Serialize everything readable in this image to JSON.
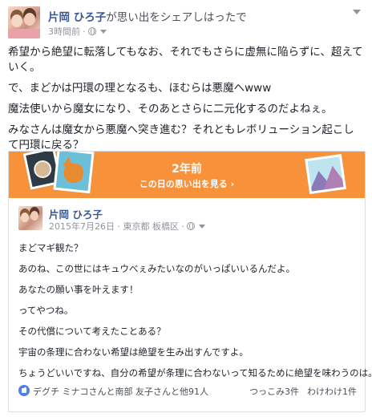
{
  "post": {
    "author": "片岡 ひろ子",
    "action": "が思い出をシェアしはったで",
    "time": "3時間前",
    "time_sep": "·",
    "paragraphs": [
      "希望から絶望に転落してもなお、それでもさらに虚無に陥らずに、超えていく。",
      "で、まどかは円環の理となるも、ほむらは悪魔へwww",
      "魔法使いから魔女になり、そのあとさらに二元化するのだよねぇ。",
      "みなさんは魔女から悪魔へ突き進む？それともレボリューション起こして円環に戻る？"
    ]
  },
  "memory": {
    "years_ago": "2年前",
    "see_memories": "この日の思い出を見る ›"
  },
  "original": {
    "author": "片岡 ひろ子",
    "date_location": "2015年7月26日 · 東京都 板橋区 ·",
    "lines": [
      "まどマギ観た？",
      "あのね、この世にはキュウべぇみたいなのがいっぱいいるんだよ。",
      "あなたの願い事を叶えます！",
      "ってやつね。",
      "その代償について考えたことある？",
      "宇宙の条理に合わない希望は絶望を生み出すんですよ。",
      "ちょうどいいですね、自分の希望が条理に合わないって知るために絶望を味わうのは。"
    ],
    "likers": "デグチ ミナコさんと南部 友子さんと他91人",
    "comments": "つっこみ3件",
    "shares": "わけわけ1件"
  },
  "colors": {
    "link_blue": "#365899",
    "banner_orange": "#f7923a",
    "like_blue": "#4f7fe8"
  }
}
